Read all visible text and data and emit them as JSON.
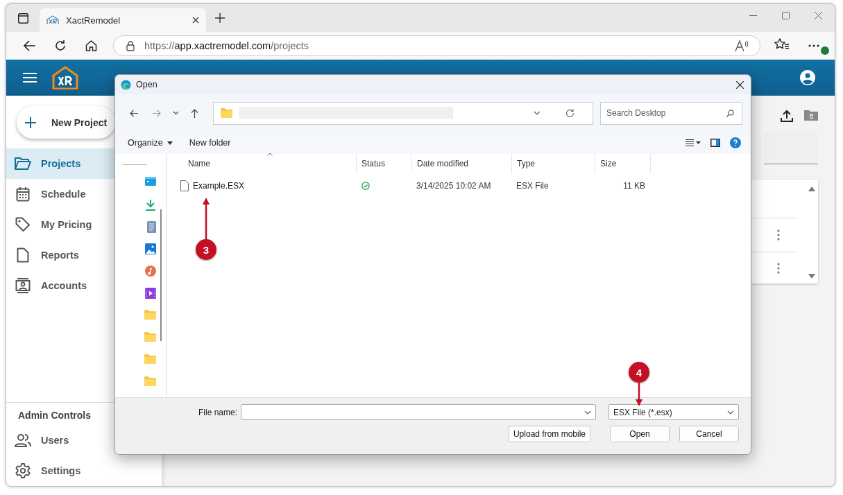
{
  "browser": {
    "tab_title": "XactRemodel",
    "url": {
      "scheme": "https://",
      "host": "app.xactremodel.com",
      "path": "/projects"
    }
  },
  "app": {
    "new_project": "New Project",
    "nav": [
      {
        "label": "Projects",
        "kind": "folder",
        "selected": true
      },
      {
        "label": "Schedule",
        "kind": "calendar",
        "selected": false
      },
      {
        "label": "My Pricing",
        "kind": "tag",
        "selected": false
      },
      {
        "label": "Reports",
        "kind": "document",
        "selected": false
      },
      {
        "label": "Accounts",
        "kind": "account",
        "selected": false
      }
    ],
    "admin": {
      "title": "Admin Controls",
      "items": [
        {
          "label": "Users",
          "kind": "users"
        },
        {
          "label": "Settings",
          "kind": "gear"
        }
      ]
    }
  },
  "dialog": {
    "title": "Open",
    "search_placeholder": "Search Desktop",
    "commands": [
      "Organize",
      "New folder"
    ],
    "quick_access": [
      {
        "kind": "desktop"
      },
      {
        "kind": "downloads"
      },
      {
        "kind": "documents"
      },
      {
        "kind": "pictures"
      },
      {
        "kind": "music"
      },
      {
        "kind": "videos"
      },
      {
        "kind": "folder"
      },
      {
        "kind": "folder"
      },
      {
        "kind": "folder"
      },
      {
        "kind": "folder"
      }
    ],
    "columns": [
      "Name",
      "Status",
      "Date modified",
      "Type",
      "Size"
    ],
    "files": [
      {
        "name": "Example.ESX",
        "synced": true,
        "date_modified": "3/14/2025 10:02 AM",
        "type": "ESX File",
        "size": "11 KB"
      }
    ],
    "file_name_label": "File name:",
    "file_type": "ESX File (*.esx)",
    "buttons": [
      "Upload from mobile",
      "Open",
      "Cancel"
    ]
  },
  "annotations": [
    {
      "number": "3",
      "kind": "up"
    },
    {
      "number": "4",
      "kind": "down"
    }
  ]
}
